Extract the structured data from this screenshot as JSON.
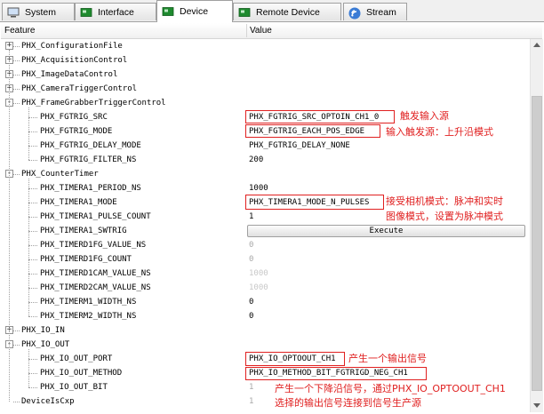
{
  "tabs": [
    {
      "label": "System",
      "icon": "computer-icon"
    },
    {
      "label": "Interface",
      "icon": "card-icon"
    },
    {
      "label": "Device",
      "icon": "card-icon",
      "active": true
    },
    {
      "label": "Remote Device",
      "icon": "card-icon"
    },
    {
      "label": "Stream",
      "icon": "stream-icon"
    }
  ],
  "header": {
    "feature": "Feature",
    "value": "Value"
  },
  "rows": [
    {
      "label": "PHX_ConfigurationFile",
      "level": 0,
      "expander": "+"
    },
    {
      "label": "PHX_AcquisitionControl",
      "level": 0,
      "expander": "+"
    },
    {
      "label": "PHX_ImageDataControl",
      "level": 0,
      "expander": "+"
    },
    {
      "label": "PHX_CameraTriggerControl",
      "level": 0,
      "expander": "+"
    },
    {
      "label": "PHX_FrameGrabberTriggerControl",
      "level": 0,
      "expander": "-"
    },
    {
      "label": "PHX_FGTRIG_SRC",
      "level": 1,
      "value": "PHX_FGTRIG_SRC_OPTOIN_CH1_0"
    },
    {
      "label": "PHX_FGTRIG_MODE",
      "level": 1,
      "value": "PHX_FGTRIG_EACH_POS_EDGE"
    },
    {
      "label": "PHX_FGTRIG_DELAY_MODE",
      "level": 1,
      "value": "PHX_FGTRIG_DELAY_NONE"
    },
    {
      "label": "PHX_FGTRIG_FILTER_NS",
      "level": 1,
      "value": "200"
    },
    {
      "label": "PHX_CounterTimer",
      "level": 0,
      "expander": "-"
    },
    {
      "label": "PHX_TIMERA1_PERIOD_NS",
      "level": 1,
      "value": "1000"
    },
    {
      "label": "PHX_TIMERA1_MODE",
      "level": 1,
      "value": "PHX_TIMERA1_MODE_N_PULSES"
    },
    {
      "label": "PHX_TIMERA1_PULSE_COUNT",
      "level": 1,
      "value": "1"
    },
    {
      "label": "PHX_TIMERA1_SWTRIG",
      "level": 1,
      "button": "Execute"
    },
    {
      "label": "PHX_TIMERD1FG_VALUE_NS",
      "level": 1,
      "value": "0",
      "grey": true
    },
    {
      "label": "PHX_TIMERD1FG_COUNT",
      "level": 1,
      "value": "0",
      "grey": true
    },
    {
      "label": "PHX_TIMERD1CAM_VALUE_NS",
      "level": 1,
      "value": "1000",
      "grey": true
    },
    {
      "label": "PHX_TIMERD2CAM_VALUE_NS",
      "level": 1,
      "value": "1000",
      "grey": true
    },
    {
      "label": "PHX_TIMERM1_WIDTH_NS",
      "level": 1,
      "value": "0"
    },
    {
      "label": "PHX_TIMERM2_WIDTH_NS",
      "level": 1,
      "value": "0"
    },
    {
      "label": "PHX_IO_IN",
      "level": 0,
      "expander": "+"
    },
    {
      "label": "PHX_IO_OUT",
      "level": 0,
      "expander": "-"
    },
    {
      "label": "PHX_IO_OUT_PORT",
      "level": 1,
      "value": "PHX_IO_OPTOOUT_CH1"
    },
    {
      "label": "PHX_IO_OUT_METHOD",
      "level": 1,
      "value": "PHX_IO_METHOD_BIT_FGTRIGD_NEG_CH1"
    },
    {
      "label": "PHX_IO_OUT_BIT",
      "level": 1,
      "value": "1",
      "grey": true
    },
    {
      "label": "DeviceIsCxp",
      "level": 0,
      "value": "1",
      "grey": true
    }
  ],
  "annotations": {
    "fgtrig_src": "触发输入源",
    "fgtrig_mode": "输入触发源：上升沿模式",
    "timer_mode_1": "接受相机模式：脉冲和实时",
    "timer_mode_2": "图像模式，设置为脉冲模式",
    "io_port": "产生一个输出信号",
    "io_bit_1": "产生一个下降沿信号，通过PHX_IO_OPTOOUT_CH1",
    "io_bit_2": "选择的输出信号连接到信号生产源"
  },
  "colors": {
    "annotation": "#e02020",
    "tab_icon_green": "#1e8a2e",
    "stream_icon_blue": "#3a7bd5"
  }
}
